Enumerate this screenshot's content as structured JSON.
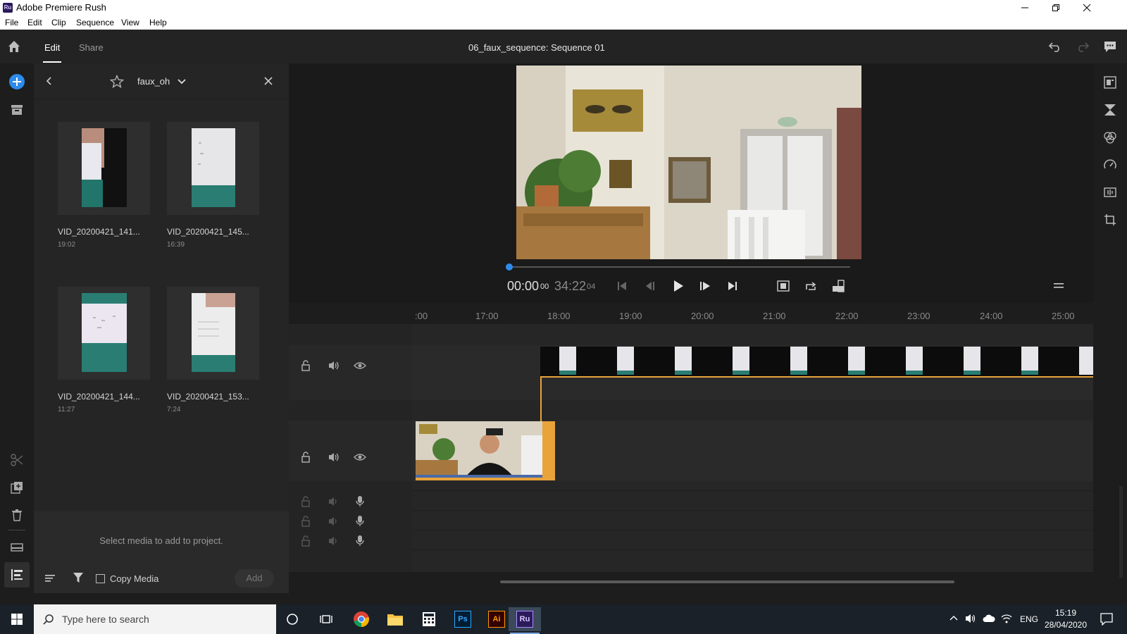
{
  "window": {
    "title": "Adobe Premiere Rush",
    "app_icon_text": "Ru"
  },
  "menu": [
    "File",
    "Edit",
    "Clip",
    "Sequence",
    "View",
    "Help"
  ],
  "topbar": {
    "tabs": [
      {
        "label": "Edit",
        "active": true
      },
      {
        "label": "Share",
        "active": false
      }
    ],
    "sequence_title": "06_faux_sequence: Sequence 01"
  },
  "media_panel": {
    "folder_name": "faux_oh",
    "items": [
      {
        "name": "VID_20200421_141...",
        "duration": "19:02"
      },
      {
        "name": "VID_20200421_145...",
        "duration": "16:39"
      },
      {
        "name": "VID_20200421_144...",
        "duration": "11:27"
      },
      {
        "name": "VID_20200421_153...",
        "duration": "7:24"
      }
    ],
    "hint": "Select media to add to project.",
    "copy_media_label": "Copy Media",
    "copy_media_checked": false,
    "add_label": "Add"
  },
  "player": {
    "current_time": "00:00",
    "current_frames": "00",
    "total_time": "34:22",
    "total_frames": "04",
    "playhead_progress": 0
  },
  "timeline": {
    "ruler_ticks": [
      ":00",
      "17:00",
      "18:00",
      "19:00",
      "20:00",
      "21:00",
      "22:00",
      "23:00",
      "24:00",
      "25:00"
    ]
  },
  "taskbar": {
    "search_placeholder": "Type here to search",
    "apps": [
      "cortana-icon",
      "task-view-icon",
      "chrome-icon",
      "file-explorer-icon",
      "calculator-icon",
      "photoshop-icon",
      "illustrator-icon",
      "premiere-rush-icon"
    ],
    "ps_label": "Ps",
    "ai_label": "Ai",
    "ru_label": "Ru",
    "language": "ENG",
    "time": "15:19",
    "date": "28/04/2020"
  },
  "colors": {
    "accent_blue": "#2d8ceb",
    "clip_orange": "#e8a33a",
    "panel": "#252525"
  }
}
